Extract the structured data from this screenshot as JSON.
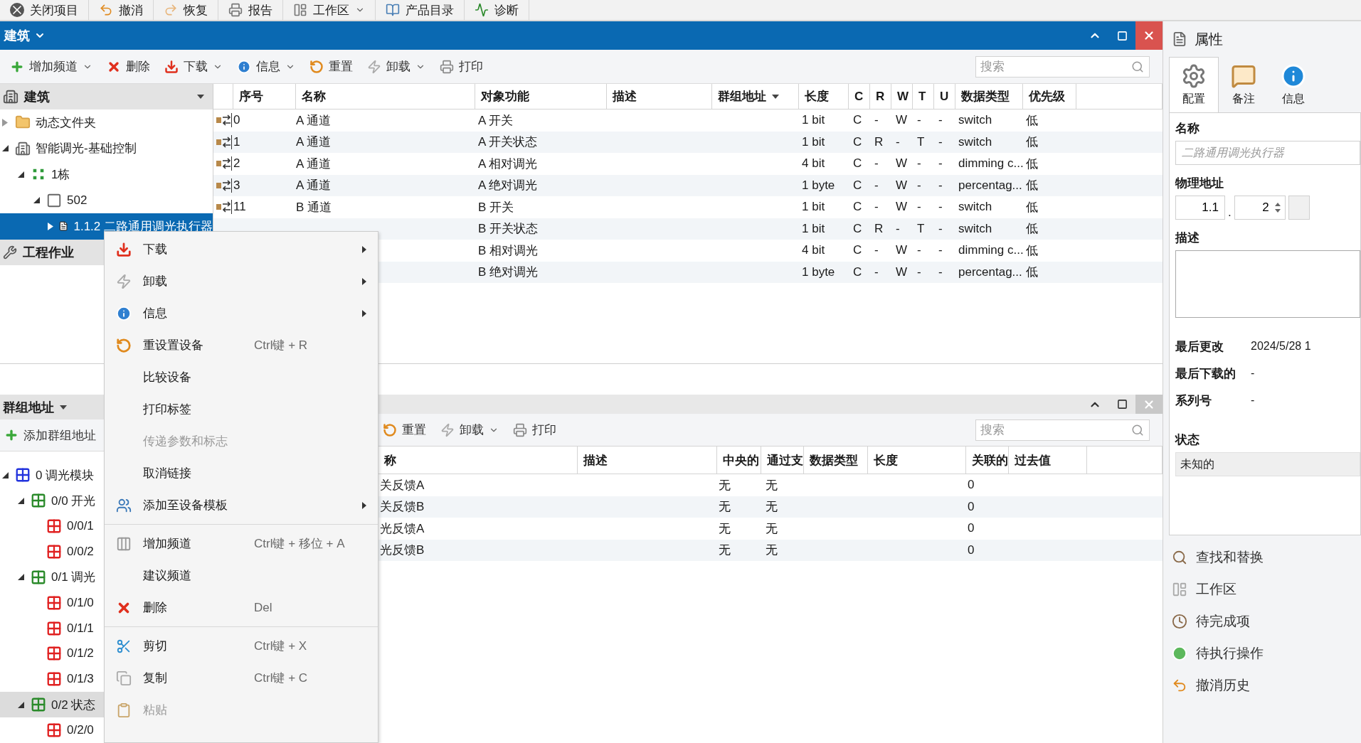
{
  "app_toolbar": [
    {
      "label": "关闭项目",
      "dropdown": false
    },
    {
      "label": "撤消",
      "dropdown": false
    },
    {
      "label": "恢复",
      "dropdown": false
    },
    {
      "label": "报告",
      "dropdown": false
    },
    {
      "label": "工作区",
      "dropdown": true
    },
    {
      "label": "产品目录",
      "dropdown": false
    },
    {
      "label": "诊断",
      "dropdown": false
    }
  ],
  "building_panel": {
    "title": "建筑",
    "toolbar": [
      {
        "label": "增加频道",
        "dropdown": true
      },
      {
        "label": "删除",
        "dropdown": false
      },
      {
        "label": "下载",
        "dropdown": true
      },
      {
        "label": "信息",
        "dropdown": true
      },
      {
        "label": "重置",
        "dropdown": false
      },
      {
        "label": "卸载",
        "dropdown": true
      },
      {
        "label": "打印",
        "dropdown": false
      }
    ],
    "search": {
      "placeholder": "搜索"
    },
    "tree_header": "建筑",
    "tree": [
      {
        "label": "动态文件夹",
        "kind": "folder",
        "expanded": false,
        "selected": false
      },
      {
        "label": "智能调光-基础控制",
        "kind": "building",
        "expanded": true,
        "selected": false,
        "children": [
          {
            "label": "1栋",
            "kind": "floor",
            "expanded": true,
            "selected": false,
            "children": [
              {
                "label": "502",
                "kind": "room",
                "expanded": true,
                "selected": false,
                "children": [
                  {
                    "label": "1.1.2 二路通用调光执行器",
                    "kind": "device",
                    "expanded": false,
                    "selected": true
                  }
                ]
              }
            ]
          }
        ]
      }
    ],
    "section_header": "工程作业",
    "columns": [
      {
        "label": "序号",
        "dropdown": false
      },
      {
        "label": "名称",
        "dropdown": false
      },
      {
        "label": "对象功能",
        "dropdown": false
      },
      {
        "label": "描述",
        "dropdown": false
      },
      {
        "label": "群组地址",
        "dropdown": true
      },
      {
        "label": "长度",
        "dropdown": false
      },
      {
        "label": "C",
        "dropdown": false
      },
      {
        "label": "R",
        "dropdown": false
      },
      {
        "label": "W",
        "dropdown": false
      },
      {
        "label": "T",
        "dropdown": false
      },
      {
        "label": "U",
        "dropdown": false
      },
      {
        "label": "数据类型",
        "dropdown": false
      },
      {
        "label": "优先级",
        "dropdown": false
      }
    ],
    "rows": [
      {
        "index": "0",
        "name": "A 通道",
        "function": "A 开关",
        "length": "1 bit",
        "c": "C",
        "r": "-",
        "w": "W",
        "t": "-",
        "u": "-",
        "data_type": "switch",
        "priority": "低"
      },
      {
        "index": "1",
        "name": "A 通道",
        "function": "A 开关状态",
        "length": "1 bit",
        "c": "C",
        "r": "R",
        "w": "-",
        "t": "T",
        "u": "-",
        "data_type": "switch",
        "priority": "低"
      },
      {
        "index": "2",
        "name": "A 通道",
        "function": "A 相对调光",
        "length": "4 bit",
        "c": "C",
        "r": "-",
        "w": "W",
        "t": "-",
        "u": "-",
        "data_type": "dimming c...",
        "priority": "低"
      },
      {
        "index": "3",
        "name": "A 通道",
        "function": "A 绝对调光",
        "length": "1 byte",
        "c": "C",
        "r": "-",
        "w": "W",
        "t": "-",
        "u": "-",
        "data_type": "percentag...",
        "priority": "低"
      },
      {
        "index": "11",
        "name": "B 通道",
        "function": "B 开关",
        "length": "1 bit",
        "c": "C",
        "r": "-",
        "w": "W",
        "t": "-",
        "u": "-",
        "data_type": "switch",
        "priority": "低"
      },
      {
        "function": "B 开关状态",
        "length": "1 bit",
        "c": "C",
        "r": "R",
        "w": "-",
        "t": "T",
        "u": "-",
        "data_type": "switch",
        "priority": "低"
      },
      {
        "function": "B 相对调光",
        "length": "4 bit",
        "c": "C",
        "r": "-",
        "w": "W",
        "t": "-",
        "u": "-",
        "data_type": "dimming c...",
        "priority": "低"
      },
      {
        "function": "B 绝对调光",
        "length": "1 byte",
        "c": "C",
        "r": "-",
        "w": "W",
        "t": "-",
        "u": "-",
        "data_type": "percentag...",
        "priority": "低"
      }
    ]
  },
  "group_panel": {
    "title": "群组地址",
    "add_button": "添加群组地址",
    "tree": [
      {
        "label": "0 调光模块",
        "kind": "main",
        "expanded": true,
        "selected": false,
        "children": [
          {
            "label": "0/0 开光",
            "kind": "middle",
            "expanded": true,
            "selected": false,
            "children": [
              {
                "label": "0/0/1",
                "kind": "address",
                "selected": false
              },
              {
                "label": "0/0/2",
                "kind": "address",
                "selected": false
              }
            ]
          },
          {
            "label": "0/1 调光",
            "kind": "middle",
            "expanded": true,
            "selected": false,
            "children": [
              {
                "label": "0/1/0",
                "kind": "address",
                "selected": false
              },
              {
                "label": "0/1/1",
                "kind": "address",
                "selected": false
              },
              {
                "label": "0/1/2",
                "kind": "address",
                "selected": false
              },
              {
                "label": "0/1/3",
                "kind": "address",
                "selected": false
              }
            ]
          },
          {
            "label": "0/2 状态",
            "kind": "middle",
            "expanded": true,
            "selected": true,
            "children": [
              {
                "label": "0/2/0",
                "kind": "address",
                "selected": false
              }
            ]
          }
        ]
      }
    ],
    "toolbar": [
      {
        "label": "重置",
        "dropdown": false
      },
      {
        "label": "卸载",
        "dropdown": true
      },
      {
        "label": "打印",
        "dropdown": false
      }
    ],
    "search": {
      "placeholder": "搜索"
    },
    "columns": [
      "称",
      "描述",
      "中央的",
      "通过支",
      "数据类型",
      "长度",
      "关联的",
      "过去值"
    ],
    "rows": [
      {
        "name": "关反馈A",
        "central": "无",
        "pass": "无",
        "linked": "0"
      },
      {
        "name": "关反馈B",
        "central": "无",
        "pass": "无",
        "linked": "0"
      },
      {
        "name": "光反馈A",
        "central": "无",
        "pass": "无",
        "linked": "0"
      },
      {
        "name": "光反馈B",
        "central": "无",
        "pass": "无",
        "linked": "0"
      }
    ]
  },
  "context_menu": {
    "groups": [
      [
        {
          "label": "下载",
          "submenu": true,
          "disabled": false
        },
        {
          "label": "卸载",
          "submenu": true,
          "disabled": false
        },
        {
          "label": "信息",
          "submenu": true,
          "disabled": false
        },
        {
          "label": "重设置设备",
          "shortcut": "Ctrl键 + R",
          "submenu": false,
          "disabled": false
        },
        {
          "label": "比较设备",
          "submenu": false,
          "disabled": false
        },
        {
          "label": "打印标签",
          "submenu": false,
          "disabled": false
        },
        {
          "label": "传递参数和标志",
          "submenu": false,
          "disabled": true
        },
        {
          "label": "取消链接",
          "submenu": false,
          "disabled": false
        },
        {
          "label": "添加至设备模板",
          "submenu": true,
          "disabled": false
        }
      ],
      [
        {
          "label": "增加频道",
          "shortcut": "Ctrl键 + 移位 + A",
          "submenu": false,
          "disabled": false
        },
        {
          "label": "建议频道",
          "submenu": false,
          "disabled": false
        },
        {
          "label": "删除",
          "shortcut": "Del",
          "submenu": false,
          "disabled": false
        }
      ],
      [
        {
          "label": "剪切",
          "shortcut": "Ctrl键 + X",
          "submenu": false,
          "disabled": false
        },
        {
          "label": "复制",
          "shortcut": "Ctrl键 + C",
          "submenu": false,
          "disabled": false
        },
        {
          "label": "粘贴",
          "submenu": false,
          "disabled": true
        }
      ]
    ]
  },
  "properties": {
    "title": "属性",
    "tabs": [
      {
        "label": "配置",
        "selected": true
      },
      {
        "label": "备注",
        "selected": false
      },
      {
        "label": "信息",
        "selected": false
      }
    ],
    "name": {
      "label": "名称",
      "placeholder": "二路通用调光执行器"
    },
    "physical_address": {
      "label": "物理地址",
      "line": "1.1",
      "separator": ".",
      "device": "2"
    },
    "description": {
      "label": "描述"
    },
    "info": [
      {
        "label": "最后更改",
        "value": "2024/5/28 1"
      },
      {
        "label": "最后下载的",
        "value": "-"
      },
      {
        "label": "系列号",
        "value": "-"
      }
    ],
    "status": {
      "label": "状态",
      "value": "未知的"
    },
    "panels": [
      "查找和替换",
      "工作区",
      "待完成项",
      "待执行操作",
      "撤消历史"
    ]
  }
}
